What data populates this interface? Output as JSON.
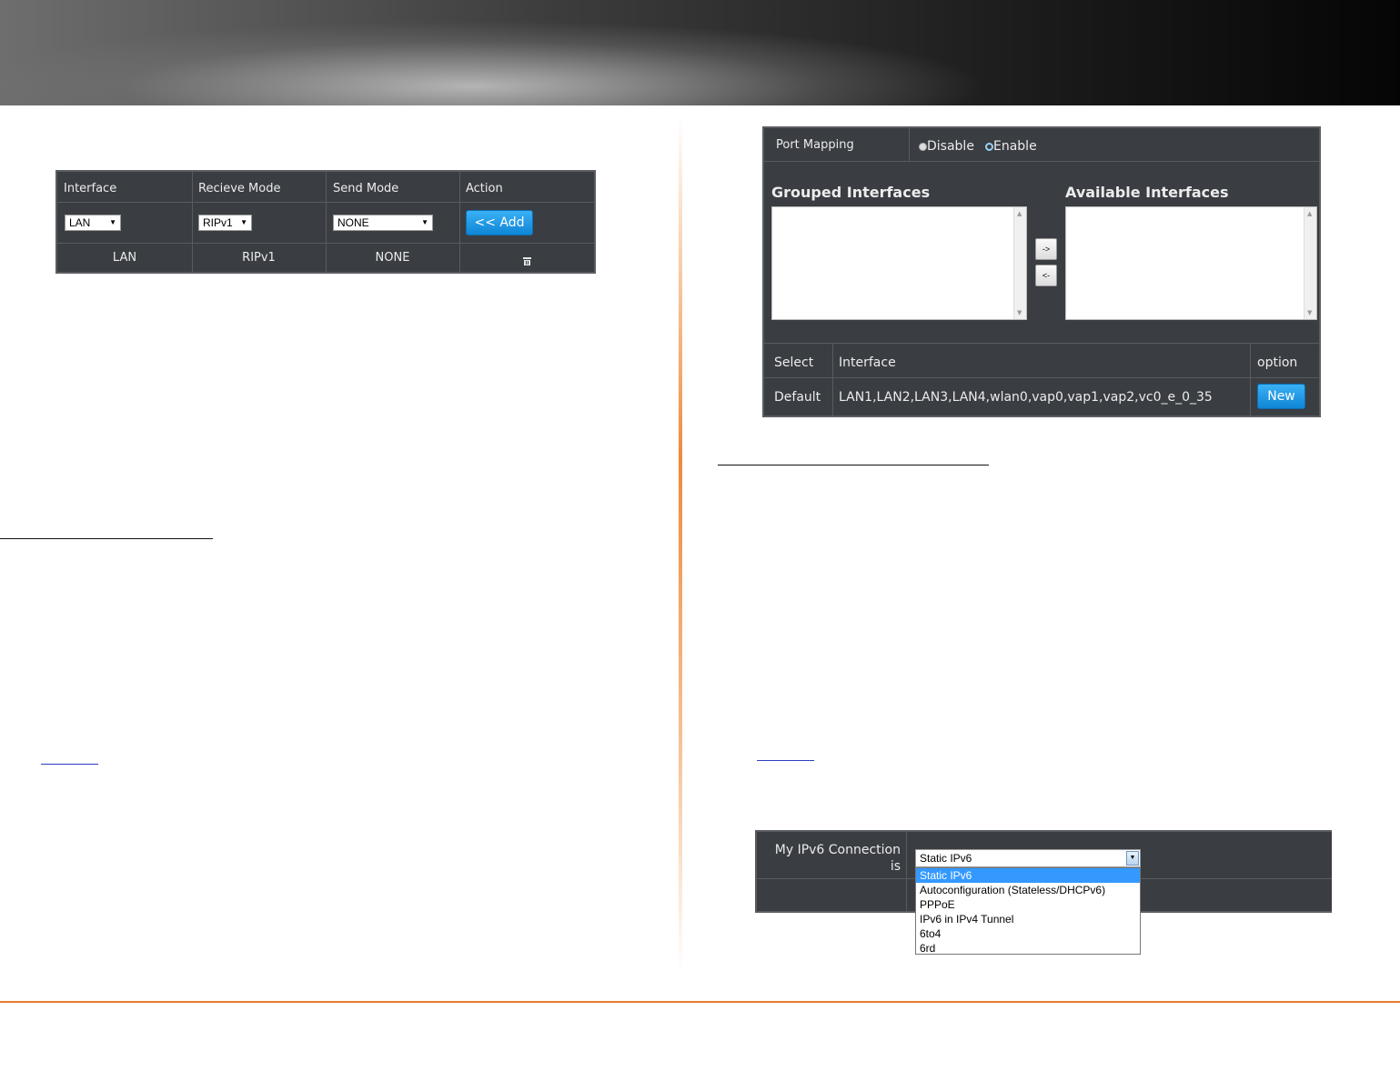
{
  "rip_table": {
    "headers": [
      "Interface",
      "Recieve Mode",
      "Send Mode",
      "Action"
    ],
    "interface_select": "LAN",
    "receive_select": "RIPv1",
    "send_select": "NONE",
    "add_button": "<< Add",
    "row": {
      "interface": "LAN",
      "receive": "RIPv1",
      "send": "NONE",
      "delete_icon": "trash-icon"
    }
  },
  "port_mapping": {
    "label": "Port Mapping",
    "disable_label": "Disable",
    "enable_label": "Enable",
    "selected": "Enable",
    "grouped_title": "Grouped Interfaces",
    "available_title": "Available Interfaces",
    "move_right": "->",
    "move_left": "<-",
    "table_headers": [
      "Select",
      "Interface",
      "option"
    ],
    "row": {
      "select": "Default",
      "interfaces": "LAN1,LAN2,LAN3,LAN4,wlan0,vap0,vap1,vap2,vc0_e_0_35",
      "button": "New"
    }
  },
  "ipv6": {
    "label": "My IPv6 Connection is",
    "selected": "Static IPv6",
    "options": [
      "Static IPv6",
      "Autoconfiguration (Stateless/DHCPv6)",
      "PPPoE",
      "IPv6 in IPv4 Tunnel",
      "6to4",
      "6rd"
    ]
  },
  "colors": {
    "panel_bg": "#3a3d42",
    "accent_blue": "#1a94e0",
    "divider_orange": "#f08a3c"
  }
}
